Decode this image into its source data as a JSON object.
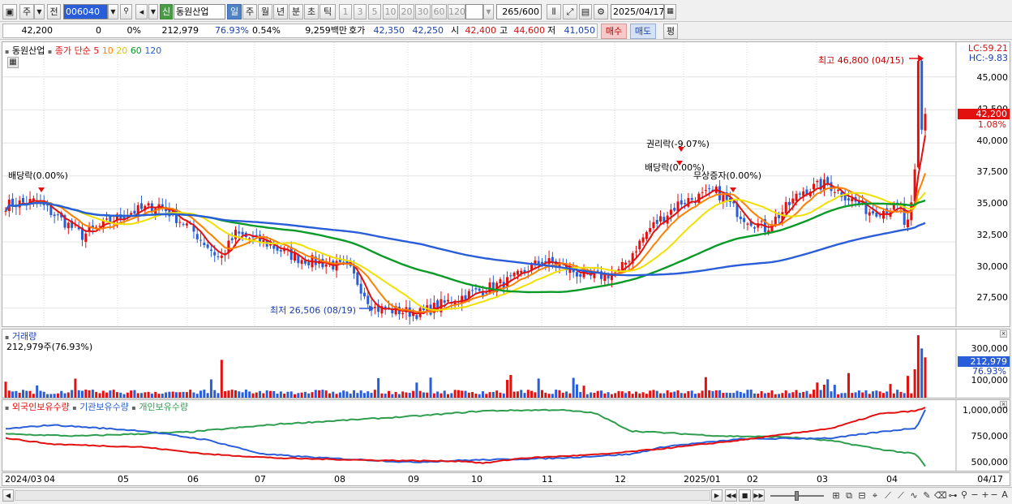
{
  "toolbar": {
    "unit_select": "주",
    "prev_label": "전",
    "stock_code": "006040",
    "badge": "신",
    "stock_name": "동원산업",
    "periods": [
      "일",
      "주",
      "월",
      "년",
      "분",
      "초",
      "틱"
    ],
    "active_period": "일",
    "intervals": [
      "1",
      "3",
      "5",
      "10",
      "20",
      "30",
      "60",
      "120"
    ],
    "count_current": "265",
    "count_total": "/600",
    "date": "2025/04/17"
  },
  "quote": {
    "price": "42,200",
    "change": "0",
    "change_pct": "0%",
    "volume": "212,979",
    "volume_ratio": "76.93%",
    "turnover_pct": "0.54%",
    "amount": "9,259백만",
    "bid_label": "호가",
    "ask_price": "42,350",
    "bid_price": "42,250",
    "open_label": "시",
    "open": "42,400",
    "high_label": "고",
    "high": "44,600",
    "low_label": "저",
    "low": "41,050",
    "buy_label": "매수",
    "sell_label": "매도",
    "eval_label": "평"
  },
  "price_pane": {
    "title": "동원산업",
    "indicator": "종가 단순",
    "ma_periods": [
      "5",
      "10",
      "20",
      "60",
      "120"
    ],
    "ma_colors": [
      "#e31010",
      "#ff8000",
      "#f0e000",
      "#0a9a28",
      "#2a5ed8"
    ],
    "lc_label": "LC:59.21",
    "hc_label": "HC:-9.83",
    "current_price": "42,200",
    "current_pct": "1.08%",
    "high_note": "최고 46,800 (04/15)",
    "low_note": "최저 26,506 (08/19)",
    "events": [
      "배당락(0.00%)",
      "권리락(-9.07%)",
      "배당락(0.00%)",
      "무상증자(0.00%)"
    ],
    "y_ticks": [
      "45,000",
      "42,500",
      "40,000",
      "37,500",
      "35,000",
      "32,500",
      "30,000",
      "27,500"
    ]
  },
  "volume_pane": {
    "title": "거래량",
    "subtitle": "212,979주(76.93%)",
    "current": "212,979",
    "current_pct": "76.93%",
    "y_ticks": [
      "300,000",
      "200,000",
      "100,000"
    ]
  },
  "holdings_pane": {
    "legend": [
      "외국인보유수량",
      "기관보유수량",
      "개인보유수량"
    ],
    "colors": [
      "#e31010",
      "#2a5ed8",
      "#2e9e4e"
    ],
    "y_ticks": [
      "1,000,000",
      "750,000",
      "500,000"
    ]
  },
  "x_axis": {
    "labels": [
      "2024/03",
      "04",
      "05",
      "06",
      "07",
      "08",
      "09",
      "10",
      "11",
      "12",
      "2025/01",
      "02",
      "03",
      "04"
    ],
    "end_label": "04/17"
  },
  "chart_data": {
    "type": "line",
    "price_approx": {
      "months": [
        "2024/03",
        "04",
        "05",
        "06",
        "07",
        "08",
        "09",
        "10",
        "11",
        "12",
        "2025/01",
        "02",
        "03",
        "04"
      ],
      "close": [
        35200,
        33000,
        34500,
        31200,
        32200,
        30500,
        27500,
        28900,
        30200,
        33500,
        35200,
        33300,
        36400,
        42200
      ],
      "high": 46800,
      "low": 26506
    },
    "ylim": [
      26000,
      47500
    ]
  }
}
